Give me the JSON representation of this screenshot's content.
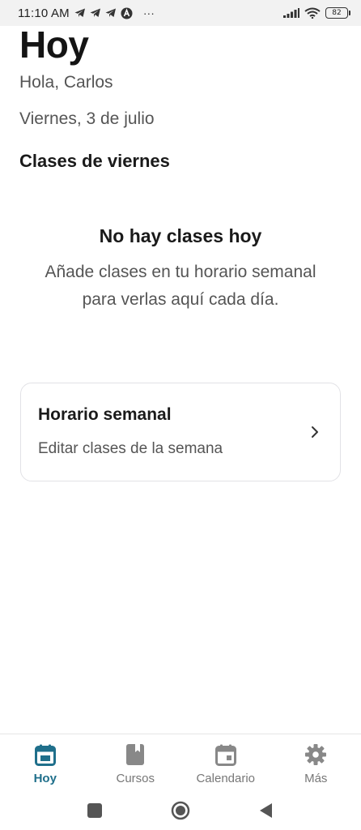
{
  "status_bar": {
    "time": "11:10 AM",
    "icons": [
      "telegram-icon",
      "telegram-icon",
      "telegram-icon",
      "angular-icon",
      "more-dots-icon"
    ],
    "overflow": "···",
    "battery_level": "82"
  },
  "header": {
    "title": "Hoy",
    "greeting": "Hola, Carlos",
    "date": "Viernes, 3 de julio"
  },
  "section": {
    "title": "Clases de viernes"
  },
  "empty_state": {
    "title": "No hay clases hoy",
    "message": "Añade clases en tu horario semanal para verlas aquí cada día."
  },
  "card": {
    "title": "Horario semanal",
    "subtitle": "Editar clases de la semana"
  },
  "bottom_nav": {
    "active_color": "#1f6f8b",
    "inactive_color": "#777777",
    "items": [
      {
        "label": "Hoy",
        "icon": "calendar-today-icon",
        "active": true
      },
      {
        "label": "Cursos",
        "icon": "book-icon",
        "active": false
      },
      {
        "label": "Calendario",
        "icon": "calendar-icon",
        "active": false
      },
      {
        "label": "Más",
        "icon": "gear-icon",
        "active": false
      }
    ]
  },
  "system_nav": {
    "buttons": [
      "recents-square-icon",
      "home-circle-icon",
      "back-triangle-icon"
    ]
  }
}
